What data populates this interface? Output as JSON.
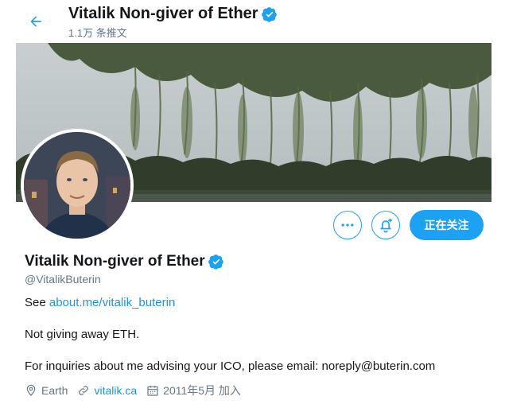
{
  "header": {
    "title": "Vitalik Non-giver of Ether",
    "tweet_count": "1.1万 条推文"
  },
  "profile": {
    "name": "Vitalik Non-giver of Ether",
    "handle": "@VitalikButerin",
    "bio": {
      "see_prefix": "See ",
      "see_link": "about.me/vitalik_buterin",
      "line2": "Not giving away ETH.",
      "line3": "For inquiries about me advising your ICO, please email: noreply@buterin.com"
    },
    "meta": {
      "location": "Earth",
      "website": "vitalik.ca",
      "joined": "2011年5月 加入"
    }
  },
  "actions": {
    "follow_label": "正在关注",
    "more_icon": "more-dots-icon",
    "notify_icon": "bell-plus-icon"
  },
  "colors": {
    "accent": "#1da1f2",
    "link": "#1b95e0",
    "secondary_text": "#657786",
    "primary_text": "#14171a"
  }
}
